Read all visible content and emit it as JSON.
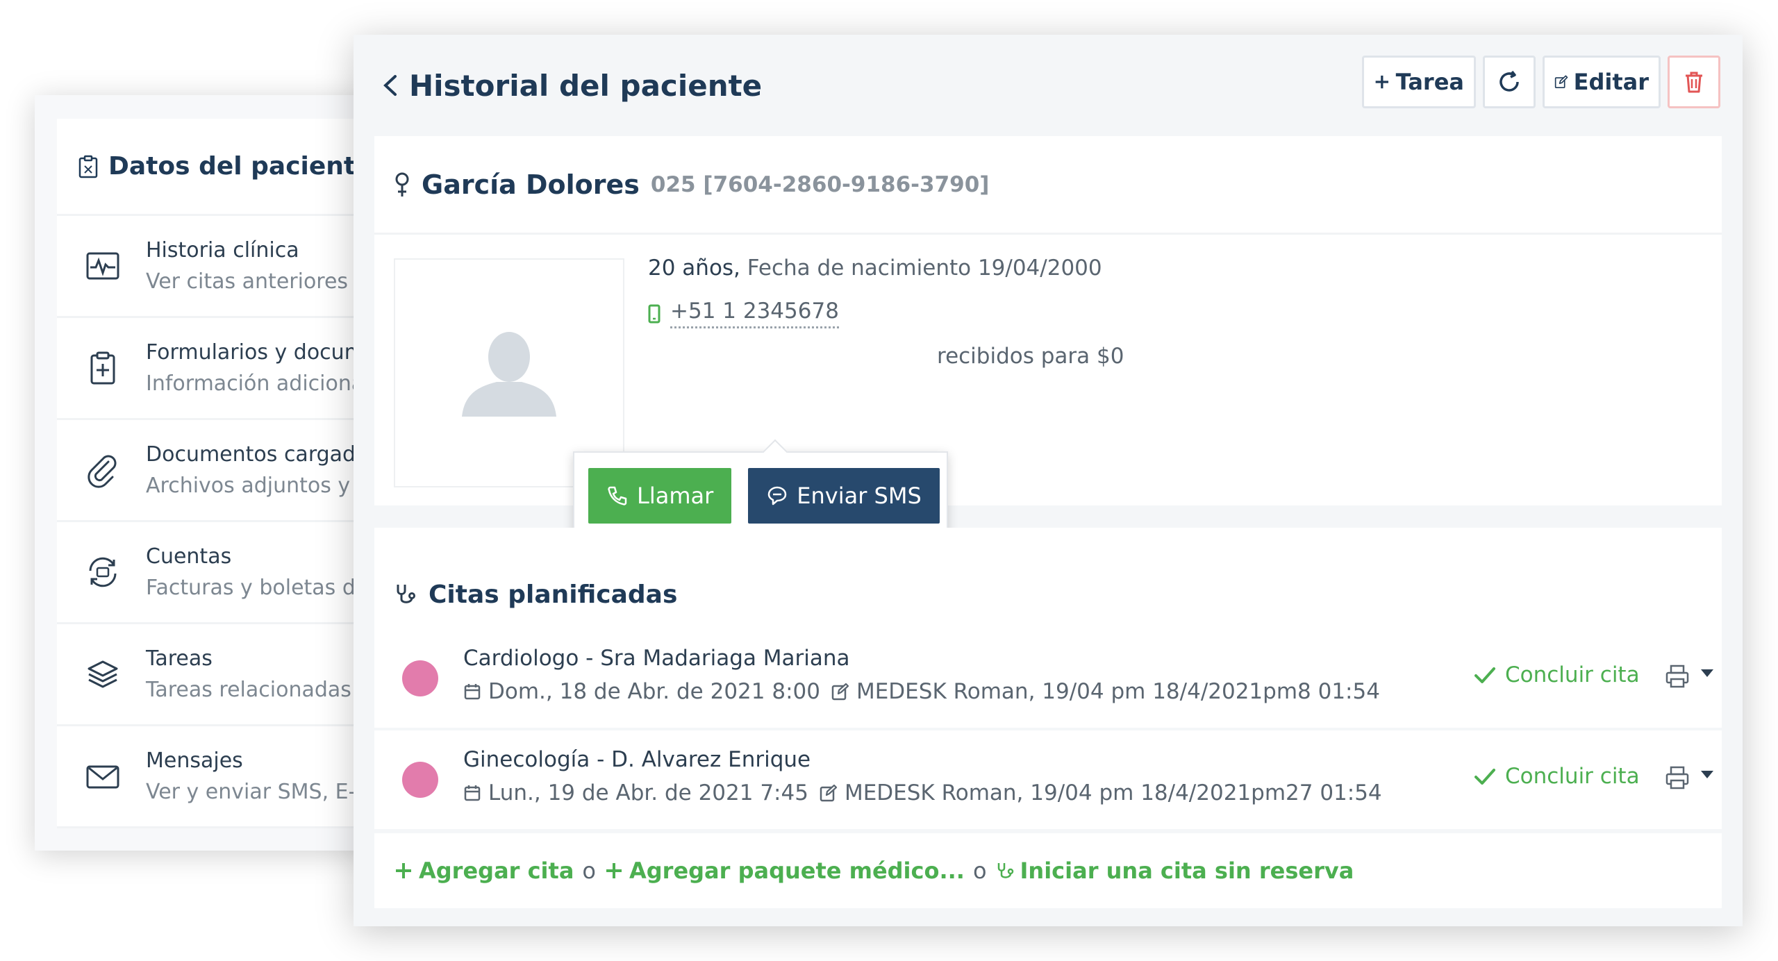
{
  "back_panel": {
    "title": "Datos del paciente",
    "items": [
      {
        "title": "Historia clínica",
        "subtitle": "Ver citas anteriores",
        "icon": "heart-monitor-icon"
      },
      {
        "title": "Formularios y docum",
        "subtitle": "Información adiciona",
        "icon": "clipboard-plus-icon"
      },
      {
        "title": "Documentos cargad",
        "subtitle": "Archivos adjuntos y d",
        "icon": "paperclip-icon"
      },
      {
        "title": "Cuentas",
        "subtitle": "Facturas y boletas de",
        "icon": "refresh-cash-icon"
      },
      {
        "title": "Tareas",
        "subtitle": "Tareas relacionadas",
        "icon": "layers-icon"
      },
      {
        "title": "Mensajes",
        "subtitle": "Ver y enviar SMS, E-m",
        "icon": "envelope-icon"
      }
    ]
  },
  "front": {
    "title": "Historial del paciente",
    "toolbar": {
      "task_label": "Tarea",
      "edit_label": "Editar"
    },
    "patient": {
      "name": "García Dolores",
      "id": "025 [7604-2860-9186-3790]",
      "age": "20 años,",
      "birth": "Fecha de nacimiento 19/04/2000",
      "phone": "+51 1 2345678",
      "payments_visible": "recibidos para $0"
    },
    "popover": {
      "call_label": "Llamar",
      "sms_label": "Enviar SMS"
    },
    "appointments_title": "Citas planificadas",
    "appointments": [
      {
        "title": "Cardiologo - Sra Madariaga Mariana",
        "date": "Dom., 18 de Abr. de 2021 8:00",
        "meta": "MEDESK Roman, 19/04 pm 18/4/2021pm8 01:54",
        "conclude": "Concluir cita",
        "dot_color": "#e27cac"
      },
      {
        "title": "Ginecología - D. Alvarez Enrique",
        "date": "Lun., 19 de Abr. de 2021 7:45",
        "meta": "MEDESK Roman, 19/04 pm 18/4/2021pm27 01:54",
        "conclude": "Concluir cita",
        "dot_color": "#e27cac"
      }
    ],
    "actions": {
      "add_appointment": "Agregar cita",
      "or1": "o",
      "add_package": "Agregar paquete médico...",
      "or2": "o",
      "walk_in": "Iniciar una cita sin reserva"
    }
  },
  "colors": {
    "primary": "#1f3a57",
    "green": "#4caf50",
    "navy_button": "#27496d",
    "appointment_dot": "#e27cac",
    "delete_border": "#f5c2c2"
  }
}
